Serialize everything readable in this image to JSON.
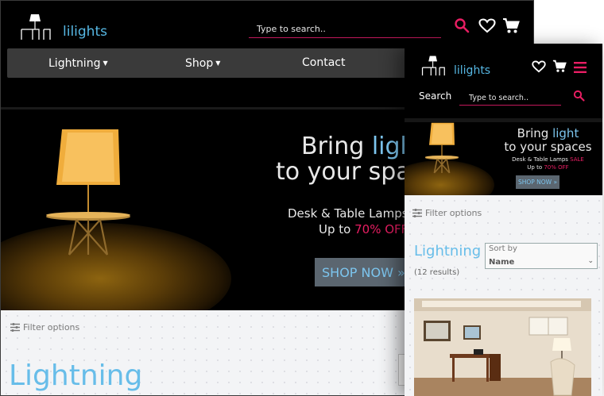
{
  "brand": {
    "name": "lilights"
  },
  "desktop": {
    "search": {
      "placeholder": "Type to search.."
    },
    "nav": [
      {
        "label": "Lightning",
        "dropdown": true
      },
      {
        "label": "Shop",
        "dropdown": true
      },
      {
        "label": "Contact",
        "dropdown": false
      }
    ],
    "hero": {
      "line1_prefix": "Bring ",
      "line1_highlight": "ligh",
      "line2": "to your spa",
      "sub1": "Desk & Table Lamps",
      "sub2_prefix": "Up to ",
      "sub2_highlight": "70% OFF",
      "button": "SHOP NOW »"
    },
    "filter_label": "Filter options",
    "page_title": "Lightning"
  },
  "mobile": {
    "search_label": "Search",
    "search": {
      "placeholder": "Type to search.."
    },
    "hero": {
      "line1_prefix": "Bring ",
      "line1_highlight": "light",
      "line2": "to your spaces",
      "sub1_prefix": "Desk & Table Lamps ",
      "sub1_highlight": "SALE",
      "sub2_prefix": "Up to ",
      "sub2_highlight": "70% OFF",
      "button": "SHOP NOW »"
    },
    "filter_label": "Filter options",
    "page_title": "Lightning",
    "results": "(12 results)",
    "sort": {
      "label": "Sort by",
      "value": "Name"
    }
  },
  "colors": {
    "accent_blue": "#67bde9",
    "accent_pink": "#e91e63",
    "header_bg": "#000000",
    "nav_bg": "#3a3a3a"
  },
  "icons": [
    "search-icon",
    "heart-icon",
    "cart-icon",
    "hamburger-icon",
    "filter-icon",
    "chevron-down-icon"
  ]
}
